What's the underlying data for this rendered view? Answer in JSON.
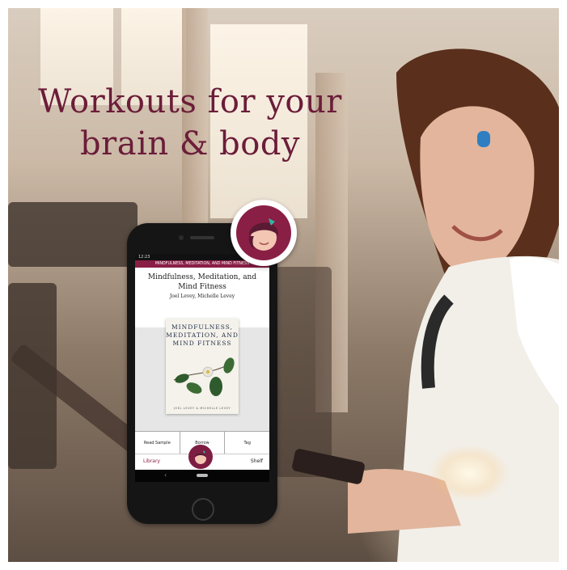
{
  "headline": {
    "line1": "Workouts for your",
    "line2": "brain & body"
  },
  "phone": {
    "status": {
      "time": "12:23",
      "icons": "◎ ●"
    },
    "topbar_title": "MINDFULNESS, MEDITATION, AND MIND FITNESS",
    "book": {
      "title": "Mindfulness, Meditation, and Mind Fitness",
      "authors": "Joel Levey, Michelle Levey",
      "cover": {
        "title_line1": "MINDFULNESS,",
        "title_line2": "MEDITATION, AND",
        "title_line3": "MIND FITNESS",
        "authors": "JOEL LEVEY & MICHELLE LEVEY"
      }
    },
    "actions": [
      "Read Sample",
      "Borrow",
      "Tag"
    ],
    "tabs": {
      "library": "Library",
      "shelf": "Shelf"
    }
  },
  "colors": {
    "brand": "#8a1f45",
    "headline": "#6b1d39"
  },
  "icons": {
    "logo": "libby-logo-icon",
    "tab_center": "libby-tab-icon",
    "back": "back-icon"
  }
}
